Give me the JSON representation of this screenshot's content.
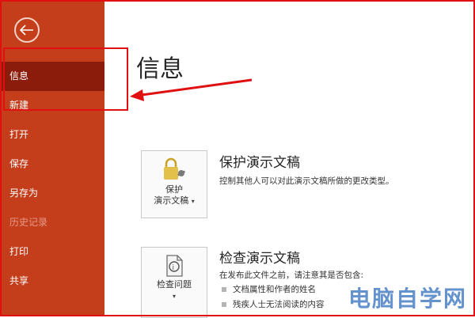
{
  "sidebar": {
    "items": [
      {
        "label": "信息",
        "state": "active"
      },
      {
        "label": "新建",
        "state": "normal"
      },
      {
        "label": "打开",
        "state": "normal"
      },
      {
        "label": "保存",
        "state": "normal"
      },
      {
        "label": "另存为",
        "state": "normal"
      },
      {
        "label": "历史记录",
        "state": "disabled"
      },
      {
        "label": "打印",
        "state": "normal"
      },
      {
        "label": "共享",
        "state": "normal"
      }
    ]
  },
  "main": {
    "title": "信息",
    "protect": {
      "button_line1": "保护",
      "button_line2": "演示文稿",
      "title": "保护演示文稿",
      "desc": "控制其他人可以对此演示文稿所做的更改类型。"
    },
    "inspect": {
      "button_label": "检查问题",
      "title": "检查演示文稿",
      "desc": "在发布此文件之前，请注意其是否包含:",
      "bullets": [
        "文档属性和作者的姓名",
        "残疾人士无法阅读的内容"
      ]
    }
  },
  "watermark": "电脑自学网",
  "colors": {
    "sidebar_bg": "#c43e1c",
    "sidebar_active": "#8b1c0b",
    "annotation": "#e01010"
  }
}
